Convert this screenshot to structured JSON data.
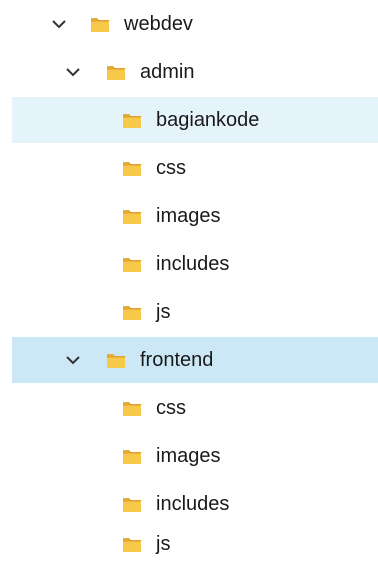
{
  "tree": {
    "root": {
      "label": "webdev",
      "icon": "folder-icon",
      "expanded": true
    },
    "admin": {
      "label": "admin",
      "icon": "folder-icon",
      "expanded": true,
      "children": [
        {
          "label": "bagiankode",
          "state": "hover"
        },
        {
          "label": "css"
        },
        {
          "label": "images"
        },
        {
          "label": "includes"
        },
        {
          "label": "js"
        }
      ]
    },
    "frontend": {
      "label": "frontend",
      "icon": "folder-icon",
      "expanded": true,
      "state": "selected",
      "children": [
        {
          "label": "css"
        },
        {
          "label": "images"
        },
        {
          "label": "includes"
        },
        {
          "label": "js"
        }
      ]
    }
  },
  "colors": {
    "hover": "#e5f3fb",
    "selected": "#cce8f7",
    "folder": "#f5c542"
  }
}
